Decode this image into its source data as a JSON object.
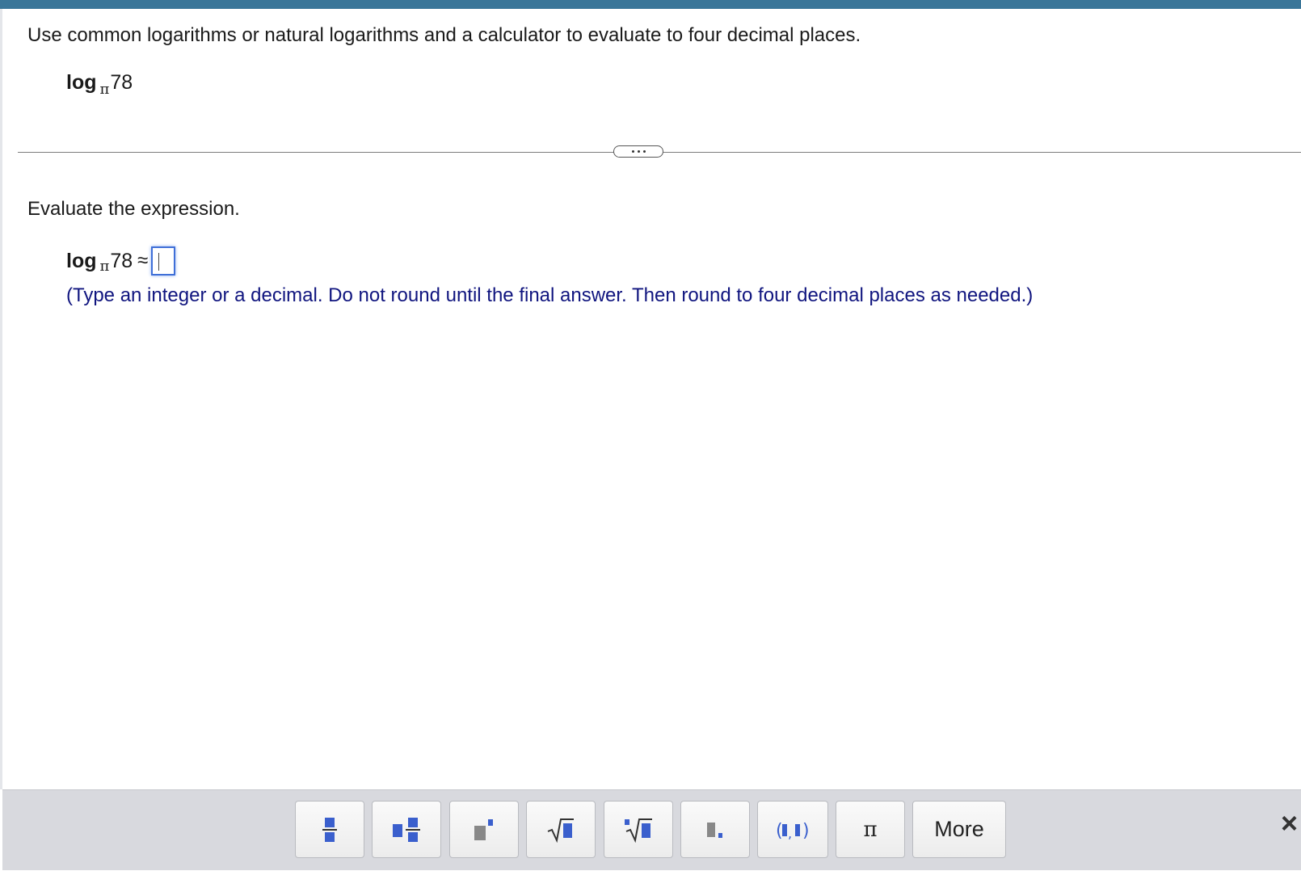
{
  "question": {
    "instruction": "Use common logarithms or natural logarithms and a calculator to evaluate to four decimal places.",
    "expression": {
      "log": "log",
      "base": "π",
      "argument": "78"
    }
  },
  "evaluate": {
    "label": "Evaluate the expression.",
    "approx_symbol": "≈",
    "answer_value": "",
    "hint": "(Type an integer or a decimal. Do not round until the final answer. Then round to four decimal places as needed.)"
  },
  "toolbar": {
    "buttons": [
      {
        "icon": "fraction-icon"
      },
      {
        "icon": "mixed-number-icon"
      },
      {
        "icon": "exponent-icon"
      },
      {
        "icon": "square-root-icon"
      },
      {
        "icon": "nth-root-icon"
      },
      {
        "icon": "decimal-icon"
      },
      {
        "icon": "ordered-pair-icon"
      },
      {
        "icon": "pi-icon",
        "label": "π"
      },
      {
        "label": "More"
      }
    ],
    "close": "×"
  },
  "colors": {
    "top_bar": "#3a7699",
    "hint_text": "#10157f",
    "input_border": "#3f6fd8",
    "icon_blue": "#3a5fcd",
    "toolbar_bg": "#d8d9de"
  }
}
